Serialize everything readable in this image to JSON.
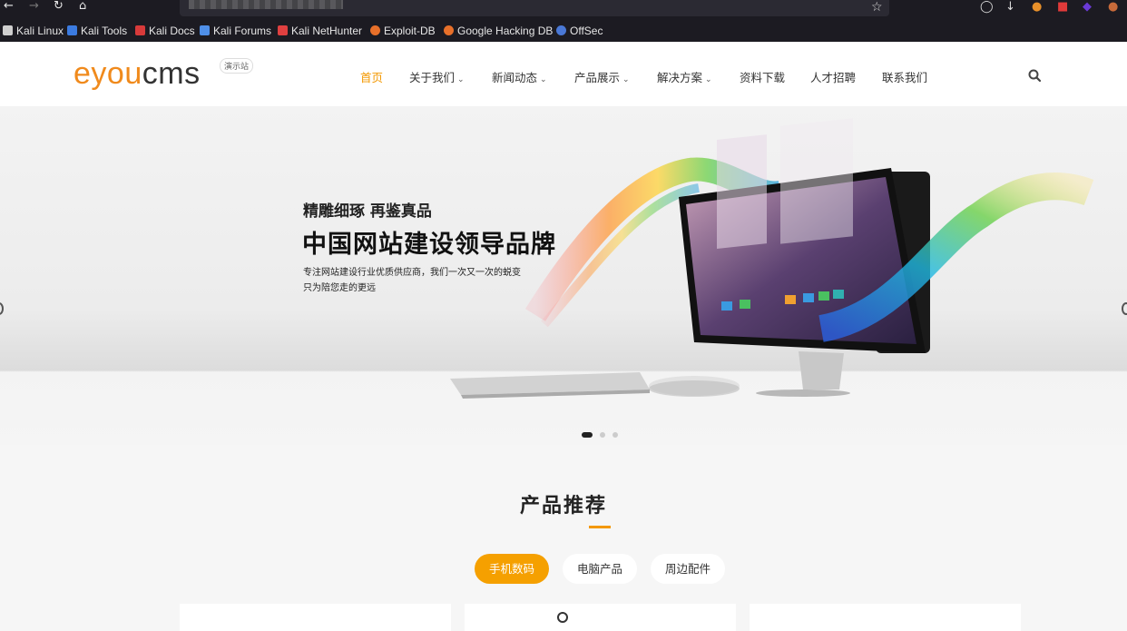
{
  "browser": {
    "bookmarks": [
      {
        "label": "Kali Linux",
        "icon": "kali-dragon-icon",
        "color": "#cfcfcf"
      },
      {
        "label": "Kali Tools",
        "icon": "kali-tools-icon",
        "color": "#3b7be0"
      },
      {
        "label": "Kali Docs",
        "icon": "kali-docs-icon",
        "color": "#d83a3a"
      },
      {
        "label": "Kali Forums",
        "icon": "kali-forums-icon",
        "color": "#4f8fe8"
      },
      {
        "label": "Kali NetHunter",
        "icon": "nethunter-icon",
        "color": "#e04040"
      },
      {
        "label": "Exploit-DB",
        "icon": "exploit-db-icon",
        "color": "#e8702a"
      },
      {
        "label": "Google Hacking DB",
        "icon": "ghdb-icon",
        "color": "#e8702a"
      },
      {
        "label": "OffSec",
        "icon": "offsec-icon",
        "color": "#4a78d6"
      }
    ]
  },
  "site": {
    "logo": {
      "e": "e",
      "you": "you",
      "cms": "cms"
    },
    "demo_badge": "演示站",
    "nav": [
      {
        "label": "首页",
        "active": true,
        "dropdown": false
      },
      {
        "label": "关于我们",
        "active": false,
        "dropdown": true
      },
      {
        "label": "新闻动态",
        "active": false,
        "dropdown": true
      },
      {
        "label": "产品展示",
        "active": false,
        "dropdown": true
      },
      {
        "label": "解决方案",
        "active": false,
        "dropdown": true
      },
      {
        "label": "资料下载",
        "active": false,
        "dropdown": false
      },
      {
        "label": "人才招聘",
        "active": false,
        "dropdown": false
      },
      {
        "label": "联系我们",
        "active": false,
        "dropdown": false
      }
    ],
    "accent_color": "#f39800"
  },
  "hero": {
    "subtitle": "精雕细琢 再鉴真品",
    "title": "中国网站建设领导品牌",
    "desc_line1": "专注网站建设行业优质供应商，我们一次又一次的蜕变",
    "desc_line2": "只为陪您走的更远",
    "slides_count": 3,
    "active_slide": 1
  },
  "products": {
    "title": "产品推荐",
    "tabs": [
      {
        "label": "手机数码",
        "active": true
      },
      {
        "label": "电脑产品",
        "active": false
      },
      {
        "label": "周边配件",
        "active": false
      }
    ]
  }
}
